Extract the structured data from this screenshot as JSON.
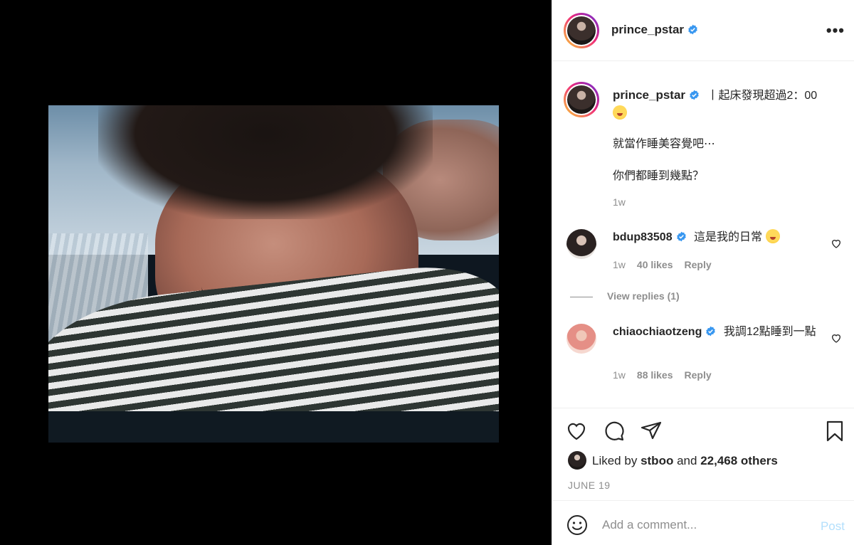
{
  "post": {
    "username": "prince_pstar",
    "more_icon": "more-options-icon",
    "photo_description_icon": "post-photo"
  },
  "caption": {
    "username": "prince_pstar",
    "line1": "丨起床發現超過2：00",
    "line2": "就當作睡美容覺吧⋯",
    "line3": "你們都睡到幾點？",
    "time": "1w"
  },
  "comments": [
    {
      "username": "bdup83508",
      "text": "這是我的日常",
      "time": "1w",
      "likes": "40 likes",
      "reply": "Reply",
      "view_replies": "View replies (1)"
    },
    {
      "username": "chiaochiaotzeng",
      "text": "我調12點睡到一點",
      "time": "1w",
      "likes": "88 likes",
      "reply": "Reply"
    }
  ],
  "actions": {
    "like_icon": "heart-icon",
    "comment_icon": "comment-icon",
    "share_icon": "share-icon",
    "save_icon": "bookmark-icon"
  },
  "likes": {
    "prefix": "Liked by",
    "user": "stboo",
    "joiner": "and",
    "others": "22,468 others"
  },
  "date": "JUNE 19",
  "add_comment": {
    "placeholder": "Add a comment...",
    "post_label": "Post"
  },
  "colors": {
    "verified": "#3897f0",
    "text": "#262626",
    "muted": "#8e8e8e",
    "post_disabled": "#b2dffc",
    "ring_start": "#f9ce34",
    "ring_mid": "#ee2a7b",
    "ring_end": "#6228d7"
  }
}
